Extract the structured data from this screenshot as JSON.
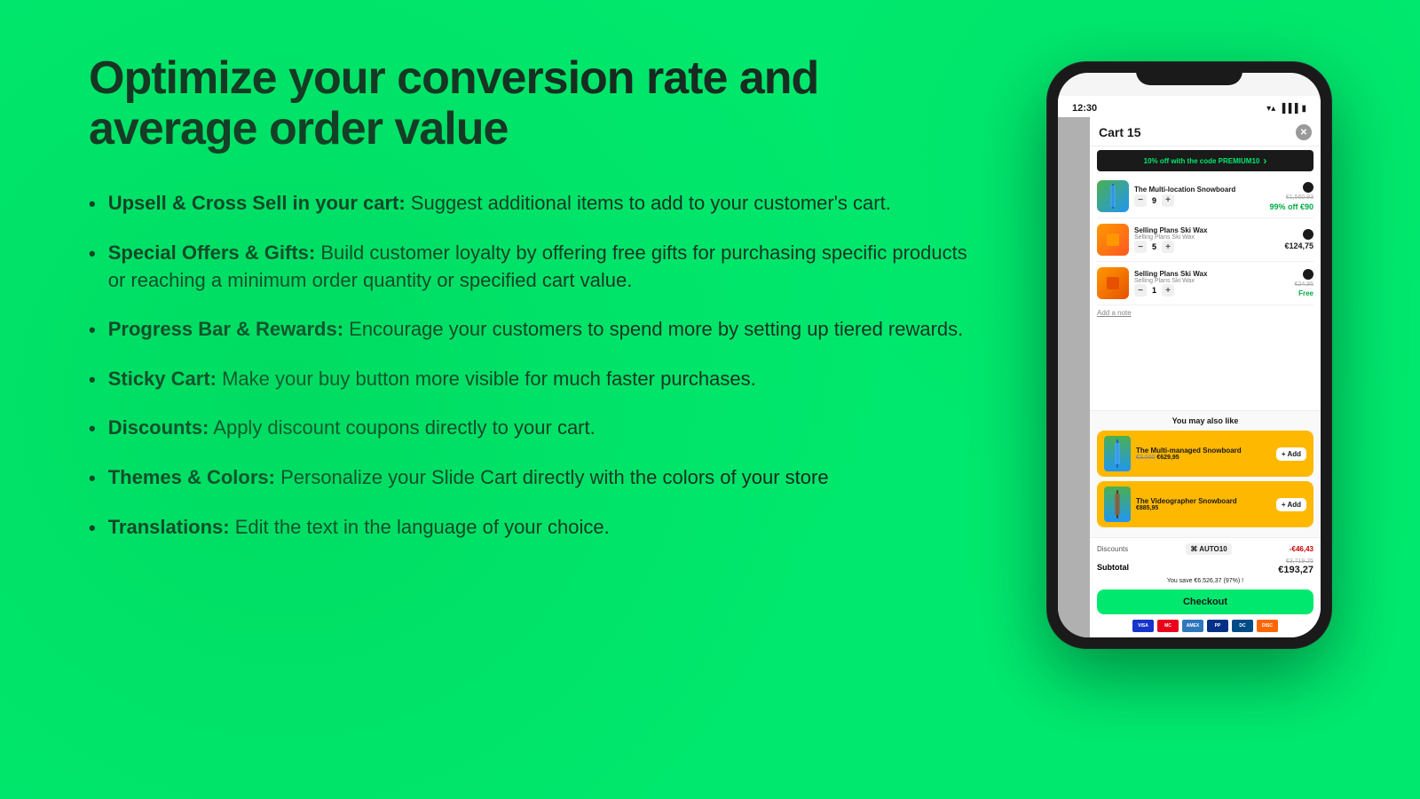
{
  "headline": {
    "line1": "Optimize your conversion rate and",
    "line2": "average order value"
  },
  "features": [
    {
      "bold": "Upsell & Cross Sell in your cart:",
      "text": " Suggest additional items to add to your customer's cart."
    },
    {
      "bold": "Special Offers & Gifts:",
      "text": " Build customer loyalty by offering free gifts for purchasing specific products or reaching a minimum order quantity or specified cart value."
    },
    {
      "bold": "Progress Bar & Rewards:",
      "text": " Encourage your customers to spend more by setting up tiered rewards."
    },
    {
      "bold": "Sticky Cart:",
      "text": " Make your buy button more visible for much faster purchases."
    },
    {
      "bold": "Discounts:",
      "text": " Apply discount coupons directly to your cart."
    },
    {
      "bold": "Themes & Colors:",
      "text": " Personalize your Slide Cart directly with the colors of your store"
    },
    {
      "bold": "Translations:",
      "text": " Edit the text in the language of your choice."
    }
  ],
  "phone": {
    "time": "12:30",
    "cart": {
      "title": "Cart",
      "count": "15",
      "promo": "10% off with the code PREMIUM10",
      "items": [
        {
          "name": "The Multi-location Snowboard",
          "type": "snowboard",
          "qty": "9",
          "price_original": "€1,560.93",
          "price_sale": "99% off €90"
        },
        {
          "name": "Selling Plans Ski Wax",
          "subtitle": "Selling Plans Ski Wax",
          "type": "wax",
          "qty": "5",
          "price": "€124,75"
        },
        {
          "name": "Selling Plans Ski Wax",
          "subtitle": "Selling Plans Ski Wax",
          "type": "wax2",
          "qty": "1",
          "price": "€24,95",
          "free": "Free"
        }
      ],
      "add_note": "Add a note",
      "upsell_title": "You may also like",
      "upsell_items": [
        {
          "name": "The Multi-managed Snowboard",
          "price_old": "€3.000",
          "price_new": "€629,95",
          "type": "snowboard2"
        },
        {
          "name": "The Videographer Snowboard",
          "price_new": "€885,95",
          "type": "snowboard3"
        }
      ],
      "discount_label": "Discounts",
      "discount_code": "AUTO10",
      "discount_amount": "-€46,43",
      "subtotal_label": "Subtotal",
      "subtotal_old": "€3,719.25",
      "subtotal_new": "€193,27",
      "savings": "You save €6.526,37 (97%) !",
      "checkout": "Checkout",
      "payment_methods": [
        "VISA",
        "MC",
        "AMEX",
        "PP",
        "DINERS",
        "DISCOVER"
      ]
    }
  }
}
